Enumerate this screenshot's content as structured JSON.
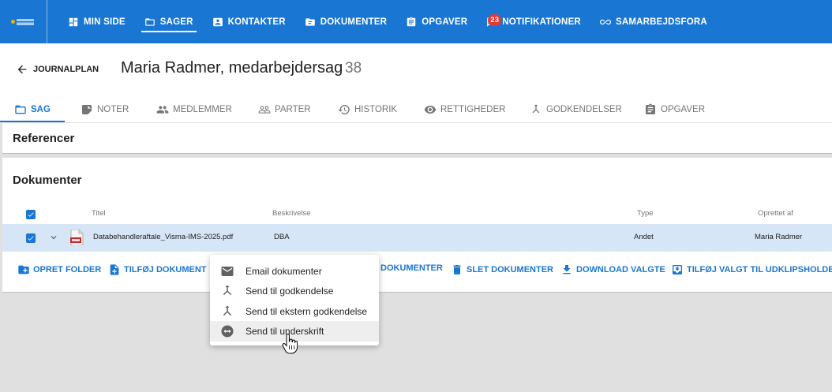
{
  "nav": {
    "items": [
      {
        "label": "MIN SIDE",
        "icon": "dashboard-icon"
      },
      {
        "label": "SAGER",
        "icon": "folder-icon",
        "active": true
      },
      {
        "label": "KONTAKTER",
        "icon": "contact-card-icon"
      },
      {
        "label": "DOKUMENTER",
        "icon": "document-folder-icon"
      },
      {
        "label": "OPGAVER",
        "icon": "clipboard-icon"
      },
      {
        "label": "NOTIFIKATIONER",
        "icon": "feedback-icon",
        "badge": "23"
      },
      {
        "label": "SAMARBEJDSFORA",
        "icon": "infinity-icon"
      }
    ],
    "accent": "#1976d2",
    "badge_color": "#e53935"
  },
  "header": {
    "back_label": "JOURNALPLAN",
    "title": "Maria Radmer, medarbejdersag",
    "count": "38"
  },
  "tabs": [
    {
      "label": "SAG",
      "icon": "folder-outline-icon",
      "active": true
    },
    {
      "label": "NOTER",
      "icon": "note-icon"
    },
    {
      "label": "MEDLEMMER",
      "icon": "people-icon"
    },
    {
      "label": "PARTER",
      "icon": "people-outline-icon"
    },
    {
      "label": "HISTORIK",
      "icon": "history-icon"
    },
    {
      "label": "RETTIGHEDER",
      "icon": "eye-icon"
    },
    {
      "label": "GODKENDELSER",
      "icon": "merge-icon"
    },
    {
      "label": "OPGAVER",
      "icon": "clipboard-icon"
    }
  ],
  "references": {
    "title": "Referencer"
  },
  "documents": {
    "title": "Dokumenter",
    "columns": {
      "title": "Titel",
      "description": "Beskrivelse",
      "type": "Type",
      "created_by": "Oprettet af"
    },
    "rows": [
      {
        "title": "Databehandleraftale_Visma-IMS-2025.pdf",
        "description": "DBA",
        "type": "Andet",
        "created_by": "Maria Radmer",
        "selected": true
      }
    ],
    "actions": {
      "create_folder": "OPRET FOLDER",
      "add_document": "TILFØJ DOKUMENT",
      "documents": "DOKUMENTER",
      "delete_documents": "SLET DOKUMENTER",
      "download_selected": "DOWNLOAD VALGTE",
      "add_to_clipboard": "TILFØJ VALGT TIL UDKLIPSHOLDER"
    }
  },
  "context_menu": {
    "items": [
      {
        "label": "Email dokumenter",
        "icon": "email-icon"
      },
      {
        "label": "Send til godkendelse",
        "icon": "merge-icon"
      },
      {
        "label": "Send til ekstern godkendelse",
        "icon": "merge-icon"
      },
      {
        "label": "Send til underskrift",
        "icon": "signature-icon",
        "hover": true
      }
    ]
  }
}
